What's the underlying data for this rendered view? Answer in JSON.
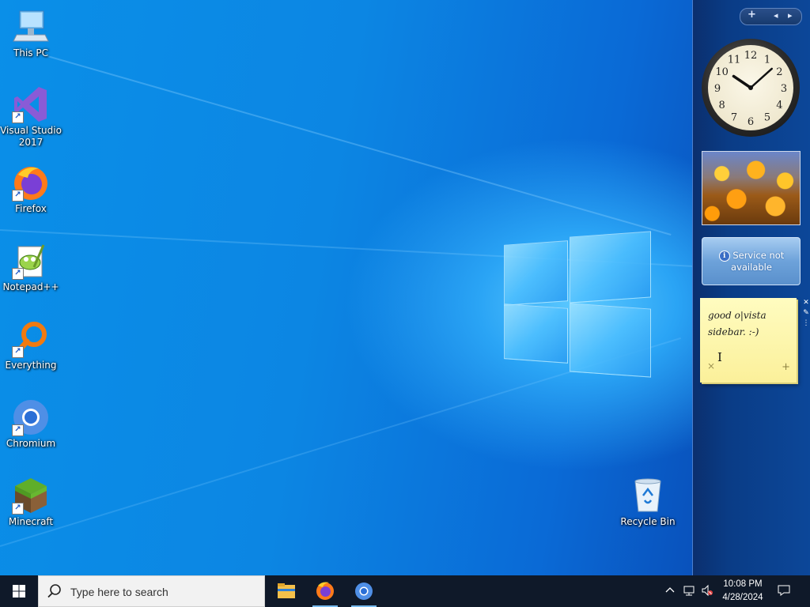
{
  "desktop": {
    "icons": [
      {
        "label": "This PC",
        "icon": "computer-icon"
      },
      {
        "label": "Visual Studio\n2017",
        "icon": "visual-studio-icon"
      },
      {
        "label": "Firefox",
        "icon": "firefox-icon"
      },
      {
        "label": "Notepad++",
        "icon": "notepadpp-icon"
      },
      {
        "label": "Everything",
        "icon": "everything-search-icon"
      },
      {
        "label": "Chromium",
        "icon": "chromium-icon"
      },
      {
        "label": "Minecraft",
        "icon": "minecraft-icon"
      },
      {
        "label": "Recycle Bin",
        "icon": "recycle-bin-icon"
      }
    ]
  },
  "sidebar": {
    "controls": {
      "add": "+",
      "prev": "◂",
      "next": "▸"
    },
    "clock": {
      "numerals": [
        "12",
        "1",
        "2",
        "3",
        "4",
        "5",
        "6",
        "7",
        "8",
        "9",
        "10",
        "11"
      ],
      "time": "10:08"
    },
    "weather": {
      "info_glyph": "i",
      "message": "Service not available"
    },
    "note": {
      "text": "good o|vista\nsidebar. :-)",
      "close": "×",
      "add": "+"
    },
    "gadget_tools": {
      "close": "✕",
      "options": "✎",
      "drag": "⋮"
    }
  },
  "taskbar": {
    "search_placeholder": "Type here to search",
    "pinned": [
      "file-explorer-icon",
      "firefox-icon",
      "chromium-icon"
    ],
    "clock": {
      "time": "10:08 PM",
      "date": "4/28/2024"
    },
    "tray": [
      "chevron-up-icon",
      "network-icon",
      "volume-muted-icon",
      "notifications-icon"
    ]
  },
  "colors": {
    "sidebar": "#0a3c86",
    "taskbar": "#0f1929",
    "accent": "#76b9ed"
  }
}
